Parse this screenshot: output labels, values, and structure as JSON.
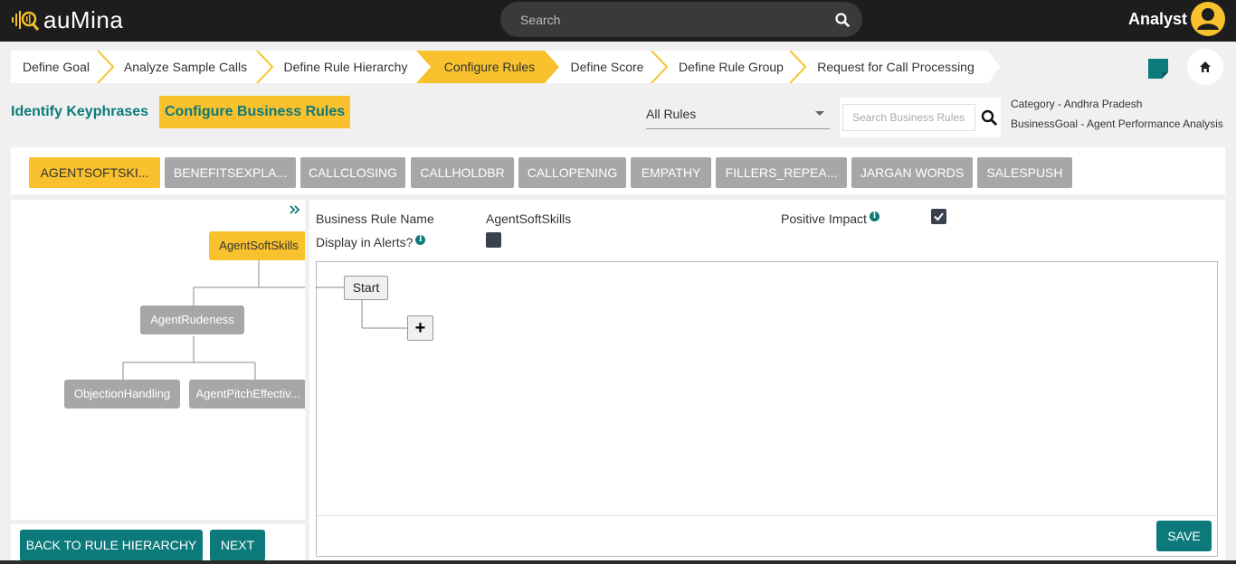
{
  "app": {
    "logo_text": "auMina",
    "search_placeholder": "Search",
    "user_role": "Analyst"
  },
  "stepper": {
    "steps": [
      {
        "label": "Define Goal"
      },
      {
        "label": "Analyze Sample Calls"
      },
      {
        "label": "Define Rule Hierarchy"
      },
      {
        "label": "Configure Rules",
        "active": true
      },
      {
        "label": "Define Score"
      },
      {
        "label": "Define Rule Group"
      },
      {
        "label": "Request for Call Processing"
      }
    ]
  },
  "subtabs": {
    "identify": "Identify Keyphrases",
    "configure": "Configure Business Rules"
  },
  "filter": {
    "selected": "All Rules",
    "search_placeholder": "Search Business Rules",
    "category": "Category - Andhra Pradesh",
    "business_goal": "BusinessGoal - Agent Performance Analysis"
  },
  "rule_tabs": [
    {
      "label": "AGENTSOFTSKI...",
      "active": true
    },
    {
      "label": "BENEFITSEXPLA..."
    },
    {
      "label": "CALLCLOSING"
    },
    {
      "label": "CALLHOLDBR"
    },
    {
      "label": "CALLOPENING"
    },
    {
      "label": "EMPATHY"
    },
    {
      "label": "FILLERS_REPEA..."
    },
    {
      "label": "JARGAN WORDS"
    },
    {
      "label": "SALESPUSH"
    }
  ],
  "tree": {
    "root": "AgentSoftSkills",
    "child": "AgentRudeness",
    "leaves": [
      "ObjectionHandling",
      "AgentPitchEffectiv..."
    ]
  },
  "rule_form": {
    "name_label": "Business Rule Name",
    "name_value": "AgentSoftSkills",
    "positive_label": "Positive Impact",
    "alerts_label": "Display in Alerts?",
    "positive_checked": true,
    "alerts_checked": false
  },
  "flow": {
    "start_label": "Start",
    "plus_label": "+"
  },
  "buttons": {
    "back": "BACK TO RULE HIERARCHY",
    "next": "NEXT",
    "save": "SAVE"
  },
  "colors": {
    "accent": "#f8c12d",
    "teal": "#0c7a7a",
    "inactive_tab": "#a7a7a7",
    "topbar": "#1d1d1d"
  }
}
